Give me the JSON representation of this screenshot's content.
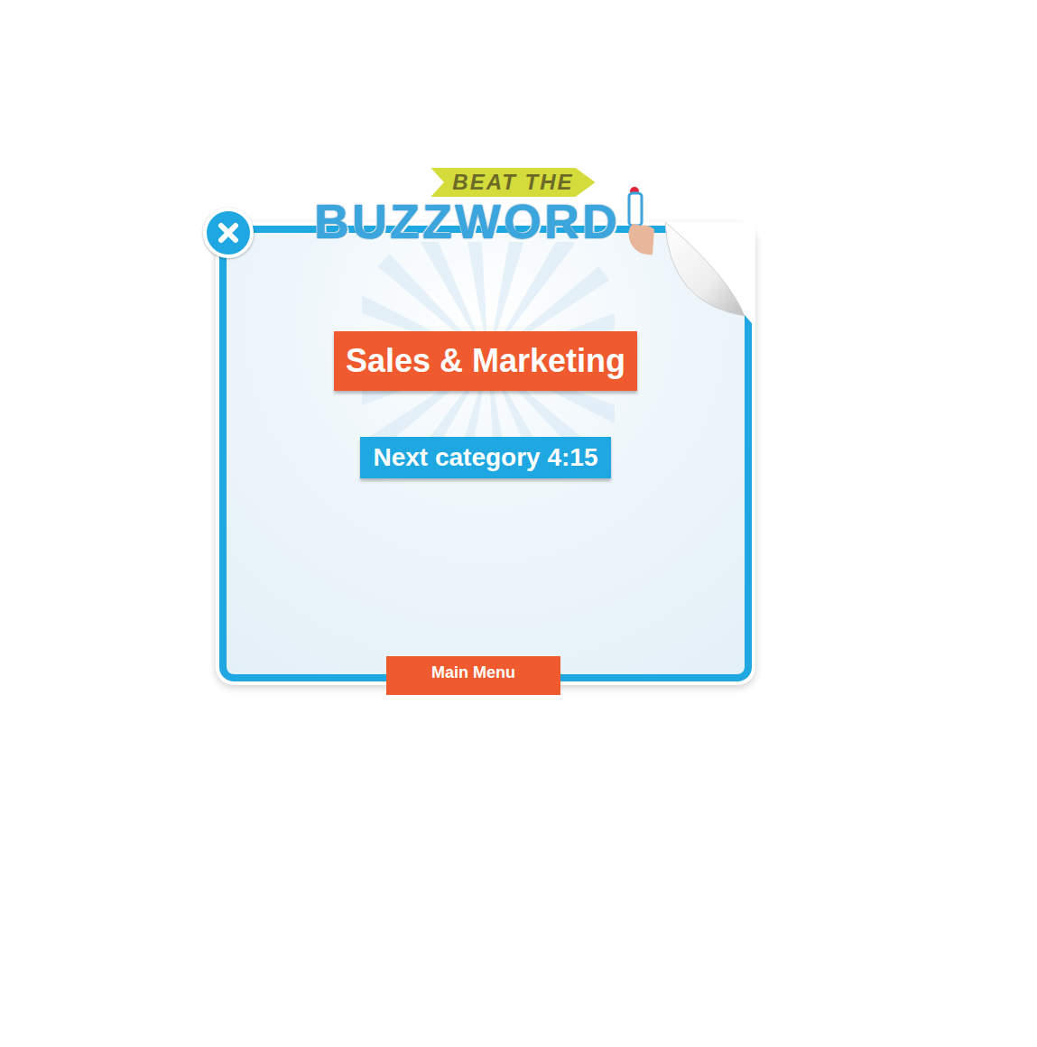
{
  "logo": {
    "tagline": "BEAT THE",
    "title": "BUZZWORD"
  },
  "category": "Sales & Marketing",
  "next_category": "Next category 4:15",
  "buttons": [
    "Main Menu"
  ]
}
